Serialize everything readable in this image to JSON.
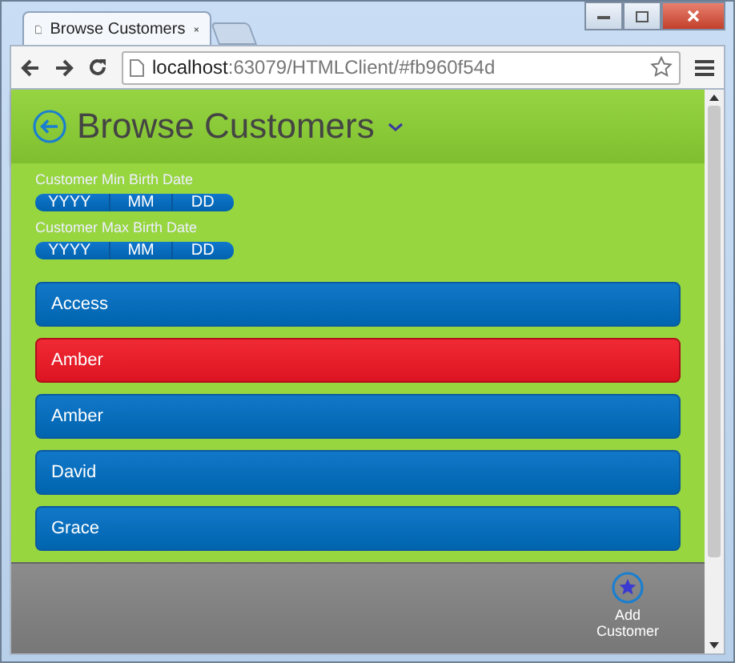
{
  "browser": {
    "tab_title": "Browse Customers",
    "url_host": "localhost",
    "url_rest": ":63079/HTMLClient/#fb960f54d"
  },
  "screen": {
    "title": "Browse Customers"
  },
  "filters": [
    {
      "label": "Customer Min Birth Date",
      "parts": [
        "YYYY",
        "MM",
        "DD"
      ]
    },
    {
      "label": "Customer Max Birth Date",
      "parts": [
        "YYYY",
        "MM",
        "DD"
      ]
    }
  ],
  "customers": [
    {
      "name": "Access",
      "selected": false
    },
    {
      "name": "Amber",
      "selected": true
    },
    {
      "name": "Amber",
      "selected": false
    },
    {
      "name": "David",
      "selected": false
    },
    {
      "name": "Grace",
      "selected": false
    }
  ],
  "footer": {
    "button": "Add Customer"
  }
}
